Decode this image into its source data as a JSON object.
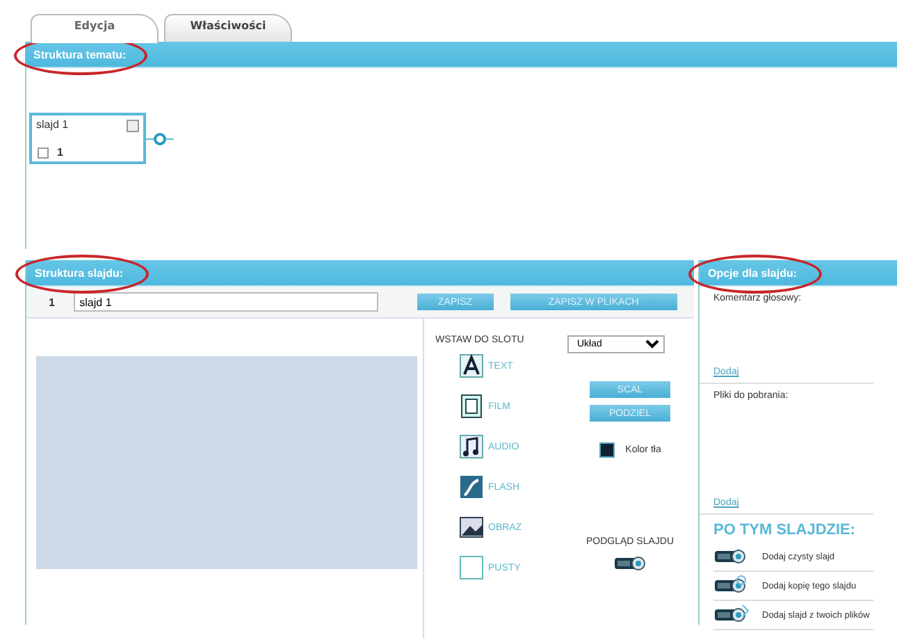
{
  "tabs": [
    {
      "label": "Edycja",
      "selected": true
    },
    {
      "label": "Właściwości",
      "selected": false
    }
  ],
  "topic_structure": {
    "title": "Struktura tematu:",
    "circled": true,
    "nodes": [
      {
        "title": "slajd 1",
        "number": "1",
        "checked": false
      }
    ]
  },
  "slide_structure": {
    "title": "Struktura slajdu:",
    "circled": true,
    "number": "1",
    "name_value": "slajd 1",
    "buttons": [
      "ZAPISZ",
      "ZAPISZ W PLIKACH"
    ],
    "insert_label": "WSTAW DO SLOTU",
    "layout_select": "Układ",
    "insert_items": [
      {
        "kind": "text",
        "label": "TEXT"
      },
      {
        "kind": "film",
        "label": "FILM"
      },
      {
        "kind": "audio",
        "label": "AUDIO"
      },
      {
        "kind": "flash",
        "label": "FLASH"
      },
      {
        "kind": "image",
        "label": "OBRAZ"
      },
      {
        "kind": "empty",
        "label": "PUSTY"
      }
    ],
    "slot_buttons": [
      "SCAL",
      "PODZIEL"
    ],
    "background_label": "Kolor tła",
    "preview_label": "PODGLĄD SLAJDU"
  },
  "slide_options": {
    "title": "Opcje dla slajdu:",
    "circled": true,
    "sections": [
      {
        "label": "Komentarz głosowy:",
        "link": "Dodaj"
      },
      {
        "label": "Pliki do pobrania:",
        "link": "Dodaj"
      }
    ],
    "after_title": "PO TYM SLAJDZIE:",
    "after_actions": [
      {
        "kind": "blank",
        "label": "Dodaj czysty slajd"
      },
      {
        "kind": "copy",
        "label": "Dodaj kopię tego slajdu"
      },
      {
        "kind": "files",
        "label": "Dodaj slajd z twoich plików"
      }
    ]
  }
}
